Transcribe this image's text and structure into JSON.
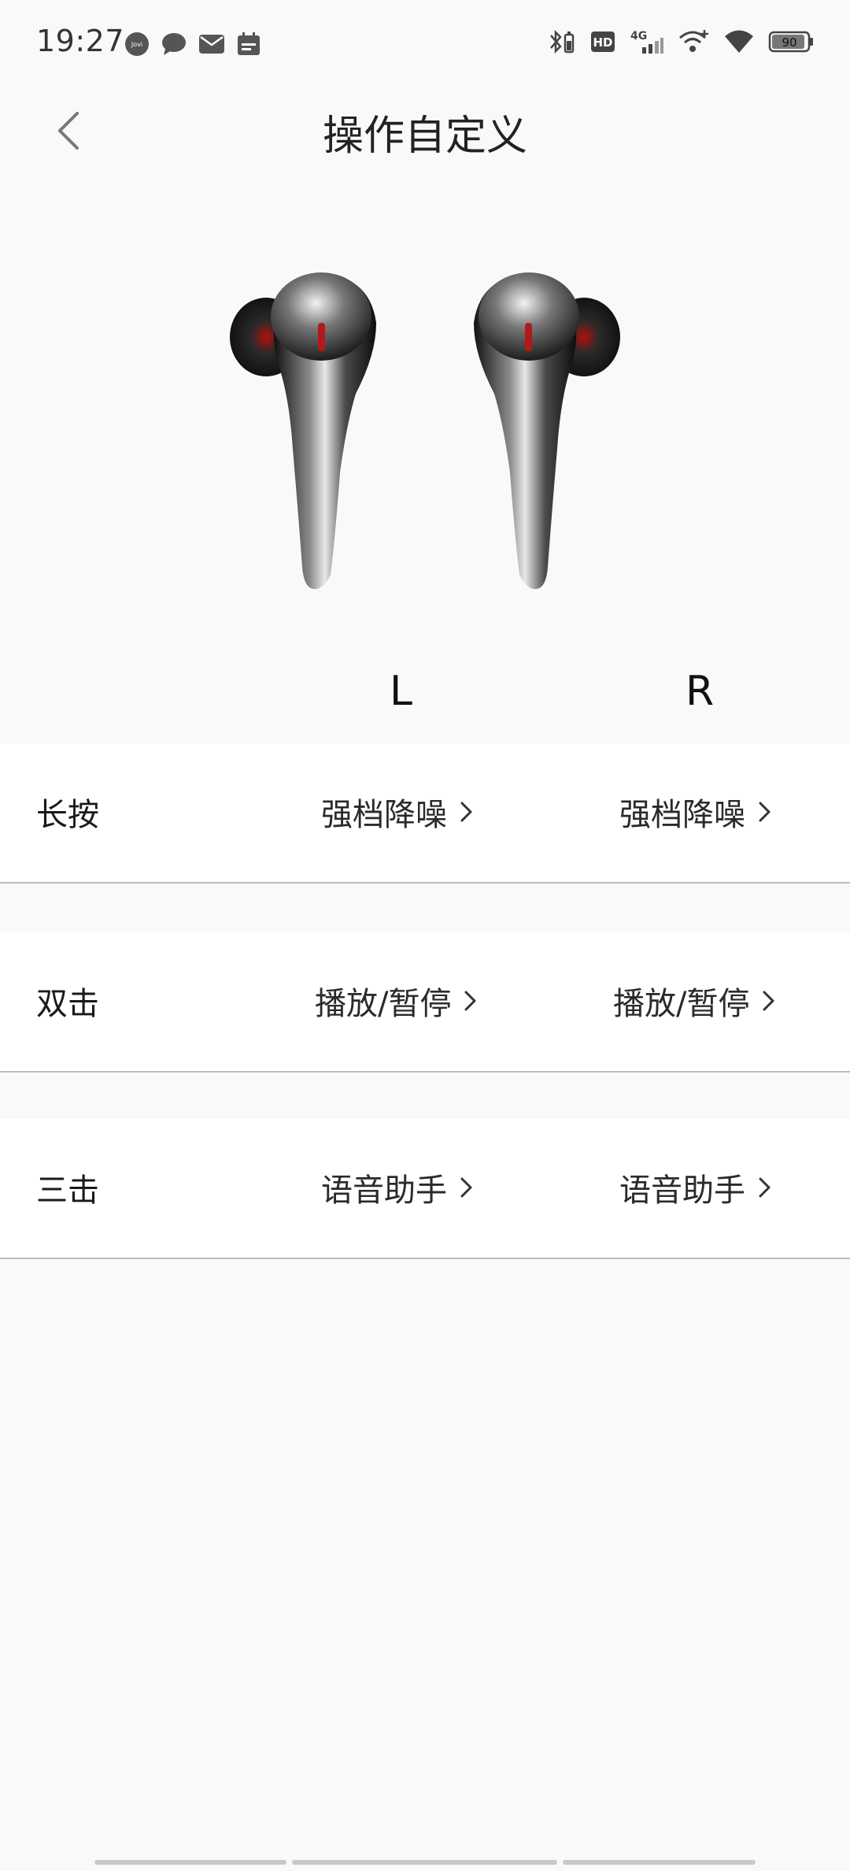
{
  "status_bar": {
    "time": "19:27",
    "left_icons": [
      "jovi-icon",
      "message-icon",
      "mail-icon",
      "calendar-icon"
    ],
    "right_icons": [
      "bluetooth-battery-icon",
      "hd-icon",
      "4g-signal-icon",
      "wifi-call-icon",
      "wifi-icon",
      "battery-icon"
    ],
    "battery": "90"
  },
  "nav": {
    "title": "操作自定义"
  },
  "earbuds_header": {
    "left": "L",
    "right": "R"
  },
  "rows": [
    {
      "label": "长按",
      "left_value": "强档降噪",
      "right_value": "强档降噪"
    },
    {
      "label": "双击",
      "left_value": "播放/暂停",
      "right_value": "播放/暂停"
    },
    {
      "label": "三击",
      "left_value": "语音助手",
      "right_value": "语音助手"
    }
  ],
  "colors": {
    "background": "#f9f9f9",
    "row_background": "#ffffff",
    "divider": "#bdbdbd",
    "accent_red": "#b11a1a"
  }
}
